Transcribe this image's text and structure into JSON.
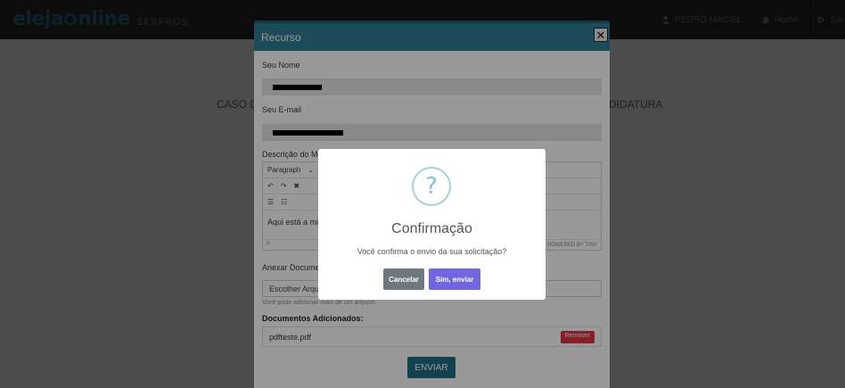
{
  "navbar": {
    "brand_part1": "eleja",
    "brand_part2": "nline",
    "brand_sub": "SERPROS",
    "user_name": "PEDRO MACIEL",
    "home_label": "Home",
    "logout_label": "Sai"
  },
  "page": {
    "heading_left": "CASO DE",
    "heading_right": "DIDATURA"
  },
  "recurso_modal": {
    "title": "Recurso",
    "close_symbol": "✕",
    "name_label": "Seu Nome",
    "email_label": "Seu E-mail",
    "description_label": "Descrição do Moti",
    "editor": {
      "block_format": "Paragraph",
      "content": "Aqui está a min",
      "status_path": "P",
      "powered_by": "POWERED BY TINY"
    },
    "attach_label": "Anexar Document",
    "file_button": "Escolher Arquiv",
    "hint": "Você pode adicionar mais de um arquivo.",
    "docs_title": "Documentos Adicionados:",
    "documents": [
      {
        "name": "pdfteste.pdf",
        "remove_label": "Remover"
      }
    ],
    "send_label": "ENVIAR"
  },
  "confirm_dialog": {
    "icon_symbol": "?",
    "title": "Confirmação",
    "text": "Você confirma o envio da sua solicitação?",
    "cancel_label": "Cancelar",
    "confirm_label": "Sim, enviar"
  },
  "colors": {
    "modal_header": "#2f7d95",
    "send_button": "#1f6e86",
    "confirm_button": "#7066e0",
    "cancel_button": "#6e7881",
    "remove_button": "#dc3545"
  }
}
